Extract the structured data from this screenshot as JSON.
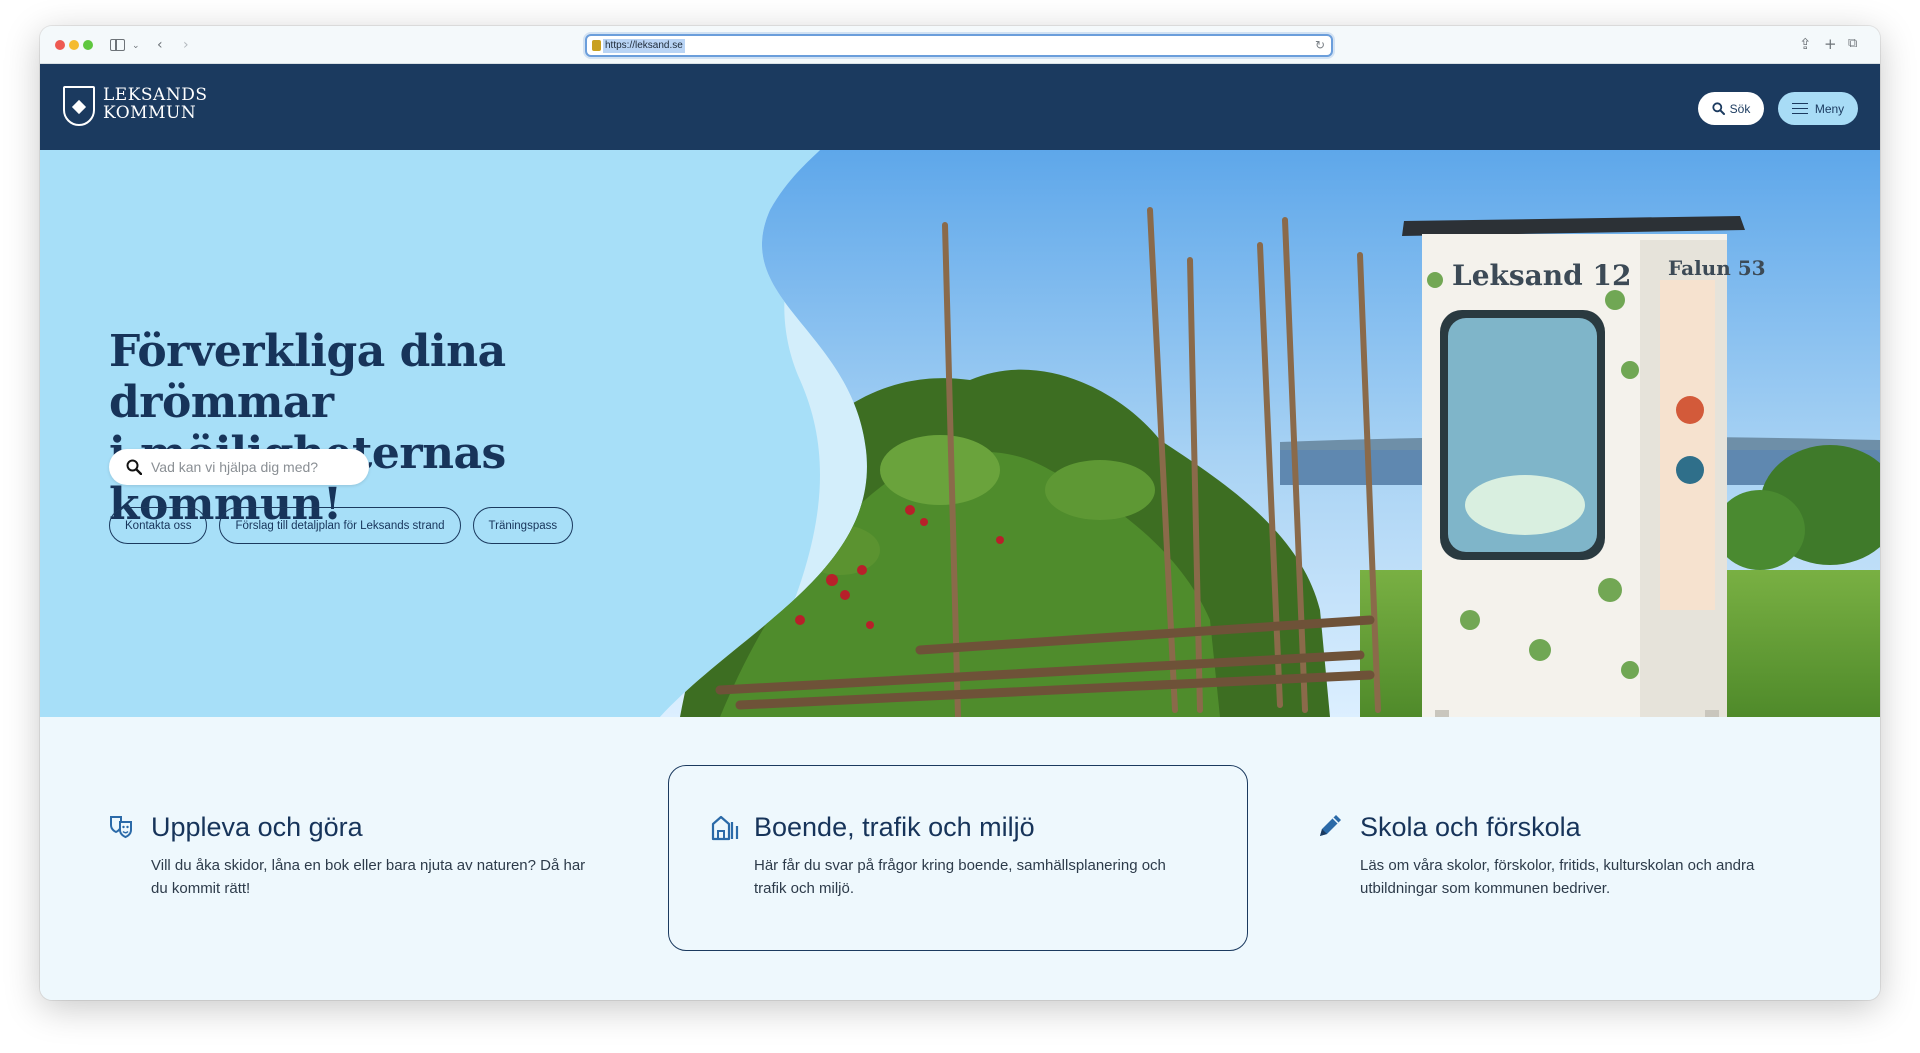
{
  "browser": {
    "url": "https://leksand.se",
    "icons": [
      "sidebar-icon",
      "chevron-down-icon",
      "back-icon",
      "forward-icon",
      "reload-icon",
      "share-icon",
      "new-tab-icon",
      "tabs-overview-icon"
    ]
  },
  "header": {
    "logo_line1": "LEKSANDS",
    "logo_line2": "KOMMUN",
    "search_label": "Sök",
    "menu_label": "Meny",
    "colors": {
      "background": "#1b3a5f",
      "menu_button": "#a8dcf6"
    }
  },
  "hero": {
    "title_line1": "Förverkliga dina drömmar",
    "title_line2": "i möjligheternas kommun!",
    "search_placeholder": "Vad kan vi hjälpa dig med?",
    "quick_links": [
      "Kontakta oss",
      "Förslag till detaljplan för Leksands strand",
      "Träningspass"
    ],
    "image_signs": [
      "Leksand 12",
      "Falun 53"
    ],
    "colors": {
      "background": "#a7dff8"
    }
  },
  "cards": [
    {
      "icon": "theater-masks-icon",
      "title": "Uppleva och göra",
      "desc_line1": "Vill du åka skidor, låna en bok eller bara njuta av naturen? Då har",
      "desc_line2": "du kommit rätt!"
    },
    {
      "icon": "houses-icon",
      "title": "Boende, trafik och miljö",
      "desc_line1": "Här får du svar på frågor kring boende, samhällsplanering och",
      "desc_line2": "trafik och miljö."
    },
    {
      "icon": "pencil-icon",
      "title": "Skola och förskola",
      "desc_line1": "Läs om våra skolor, förskolor, fritids, kulturskolan och andra",
      "desc_line2": "utbildningar som kommunen bedriver."
    }
  ]
}
